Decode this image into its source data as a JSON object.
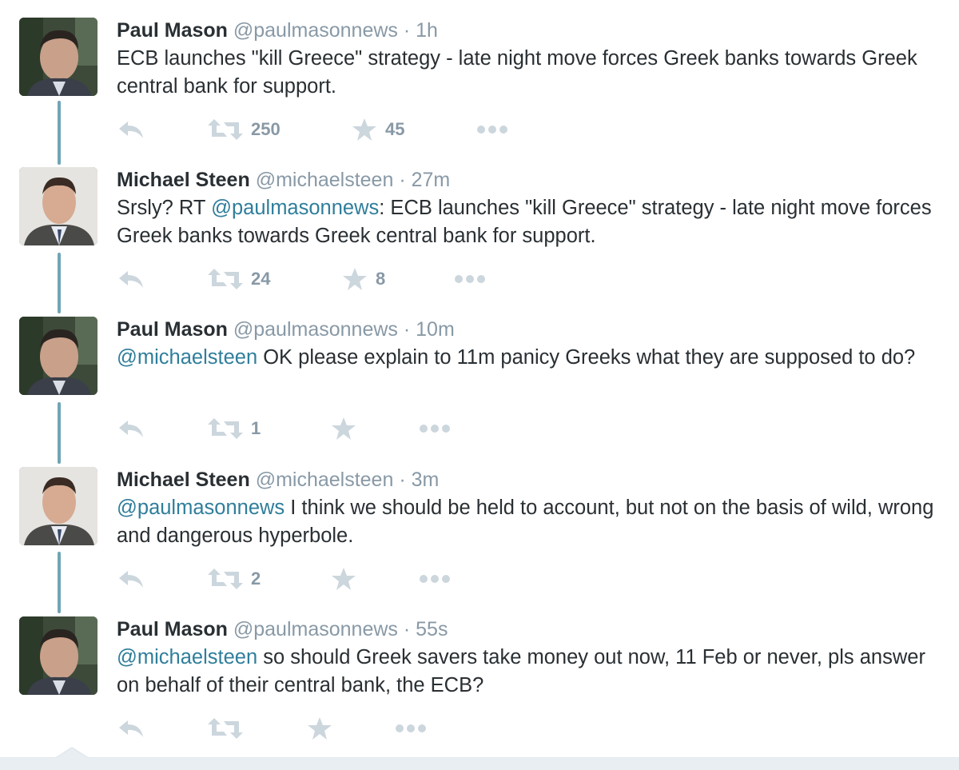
{
  "colors": {
    "text": "#292f33",
    "muted": "#8899a6",
    "mention": "#2f7e9b",
    "connector": "#6fa5b4",
    "action_icon": "#ccd6dd"
  },
  "icons": {
    "reply": "reply-icon",
    "retweet": "retweet-icon",
    "favorite": "star-icon",
    "more": "more-dots-icon"
  },
  "tweets": [
    {
      "name": "Paul Mason",
      "handle": "@paulmasonnews",
      "sep": "·",
      "time": "1h",
      "mention": "",
      "body": "ECB launches \"kill Greece\" strategy - late night move forces Greek banks towards Greek central bank for support.",
      "retweets": "250",
      "favorites": "45"
    },
    {
      "name": "Michael Steen",
      "handle": "@michaelsteen",
      "sep": "·",
      "time": "27m",
      "prefix": "Srsly? RT ",
      "mention": "@paulmasonnews",
      "body": ": ECB launches \"kill Greece\" strategy - late night move forces Greek banks towards Greek central bank for support.",
      "retweets": "24",
      "favorites": "8"
    },
    {
      "name": "Paul Mason",
      "handle": "@paulmasonnews",
      "sep": "·",
      "time": "10m",
      "mention": "@michaelsteen",
      "body": " OK please explain to 11m panicy Greeks what they are supposed to do?",
      "retweets": "1",
      "favorites": ""
    },
    {
      "name": "Michael Steen",
      "handle": "@michaelsteen",
      "sep": "·",
      "time": "3m",
      "mention": "@paulmasonnews",
      "body": " I think we should be held to account, but not on the basis of wild, wrong and dangerous hyperbole.",
      "retweets": "2",
      "favorites": ""
    },
    {
      "name": "Paul Mason",
      "handle": "@paulmasonnews",
      "sep": "·",
      "time": "55s",
      "mention": "@michaelsteen",
      "body": " so should Greek savers take money out now, 11 Feb or never, pls answer on behalf of their central bank, the ECB?",
      "retweets": "",
      "favorites": ""
    }
  ]
}
